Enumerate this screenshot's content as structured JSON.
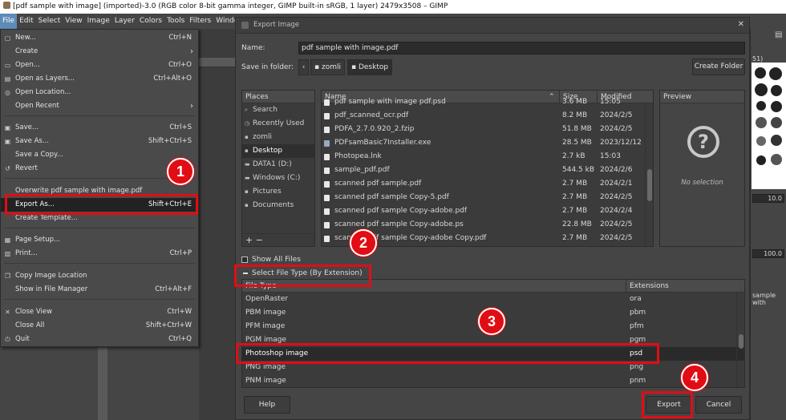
{
  "window": {
    "title": "[pdf sample with image] (imported)-3.0 (RGB color 8-bit gamma integer, GIMP built-in sRGB, 1 layer) 2479x3508 – GIMP"
  },
  "menubar": [
    "File",
    "Edit",
    "Select",
    "View",
    "Image",
    "Layer",
    "Colors",
    "Tools",
    "Filters",
    "Window"
  ],
  "file_menu": {
    "new": {
      "label": "New...",
      "shortcut": "Ctrl+N"
    },
    "create": {
      "label": "Create"
    },
    "open": {
      "label": "Open...",
      "shortcut": "Ctrl+O"
    },
    "open_layers": {
      "label": "Open as Layers...",
      "shortcut": "Ctrl+Alt+O"
    },
    "open_location": {
      "label": "Open Location..."
    },
    "open_recent": {
      "label": "Open Recent"
    },
    "save": {
      "label": "Save...",
      "shortcut": "Ctrl+S"
    },
    "save_as": {
      "label": "Save As...",
      "shortcut": "Shift+Ctrl+S"
    },
    "save_copy": {
      "label": "Save a Copy..."
    },
    "revert": {
      "label": "Revert"
    },
    "overwrite": {
      "label": "Overwrite pdf sample with image.pdf"
    },
    "export_as": {
      "label": "Export As...",
      "shortcut": "Shift+Ctrl+E"
    },
    "create_template": {
      "label": "Create Template..."
    },
    "page_setup": {
      "label": "Page Setup..."
    },
    "print": {
      "label": "Print...",
      "shortcut": "Ctrl+P"
    },
    "copy_location": {
      "label": "Copy Image Location"
    },
    "show_manager": {
      "label": "Show in File Manager",
      "shortcut": "Ctrl+Alt+F"
    },
    "close_view": {
      "label": "Close View",
      "shortcut": "Ctrl+W"
    },
    "close_all": {
      "label": "Close All",
      "shortcut": "Shift+Ctrl+W"
    },
    "quit": {
      "label": "Quit",
      "shortcut": "Ctrl+Q"
    }
  },
  "dialog": {
    "title": "Export Image",
    "name_label": "Name:",
    "name_value": "pdf sample with image.pdf",
    "folder_label": "Save in folder:",
    "breadcrumbs": [
      "zomli",
      "Desktop"
    ],
    "create_folder": "Create Folder",
    "places_header": "Places",
    "places": [
      "Search",
      "Recently Used",
      "zomli",
      "Desktop",
      "DATA1 (D:)",
      "Windows (C:)",
      "Pictures",
      "Documents"
    ],
    "places_footer": "+ −",
    "columns": {
      "name": "Name",
      "size": "Size",
      "modified": "Modified"
    },
    "files": [
      {
        "name": "pdf sample with image pdf.psd",
        "size": "3.6 MB",
        "modified": "15:05"
      },
      {
        "name": "pdf_scanned_ocr.pdf",
        "size": "8.2 MB",
        "modified": "2024/2/5"
      },
      {
        "name": "PDFA_2.7.0.920_2.fzip",
        "size": "51.8 MB",
        "modified": "2024/2/5"
      },
      {
        "name": "PDFsamBasic7Installer.exe",
        "size": "28.5 MB",
        "modified": "2023/12/12"
      },
      {
        "name": "Photopea.lnk",
        "size": "2.7 kB",
        "modified": "15:03"
      },
      {
        "name": "sample_pdf.pdf",
        "size": "544.5 kB",
        "modified": "2024/2/6"
      },
      {
        "name": "scanned pdf sample.pdf",
        "size": "2.7 MB",
        "modified": "2024/2/1"
      },
      {
        "name": "scanned pdf sample Copy-5.pdf",
        "size": "2.7 MB",
        "modified": "2024/2/5"
      },
      {
        "name": "scanned pdf sample Copy-adobe.pdf",
        "size": "2.7 MB",
        "modified": "2024/2/4"
      },
      {
        "name": "scanned pdf sample Copy-adobe.ps",
        "size": "22.8 MB",
        "modified": "2024/2/5"
      },
      {
        "name": "scanned pdf sample Copy-adobe Copy.pdf",
        "size": "2.7 MB",
        "modified": "2024/2/5"
      }
    ],
    "preview_header": "Preview",
    "preview_empty": "No selection",
    "show_all_files": "Show All Files",
    "select_file_type": "Select File Type (By Extension)",
    "type_columns": {
      "type": "File Type",
      "ext": "Extensions"
    },
    "file_types": [
      {
        "type": "OpenRaster",
        "ext": "ora"
      },
      {
        "type": "PBM image",
        "ext": "pbm"
      },
      {
        "type": "PFM image",
        "ext": "pfm"
      },
      {
        "type": "PGM image",
        "ext": "pgm"
      },
      {
        "type": "Photoshop image",
        "ext": "psd"
      },
      {
        "type": "PNG image",
        "ext": "png"
      },
      {
        "type": "PNM image",
        "ext": "pnm"
      }
    ],
    "help": "Help",
    "export": "Export",
    "cancel": "Cancel"
  },
  "annotations": [
    "1",
    "2",
    "3",
    "4"
  ],
  "right_dock": {
    "brush_size": "10.0",
    "opacity": "100.0",
    "tab_label": "sample with",
    "scale_label": "51)"
  },
  "colors": {
    "highlight": "#e10d14",
    "menu_bg": "#4a4a4a",
    "dialog_bg": "#454545"
  }
}
